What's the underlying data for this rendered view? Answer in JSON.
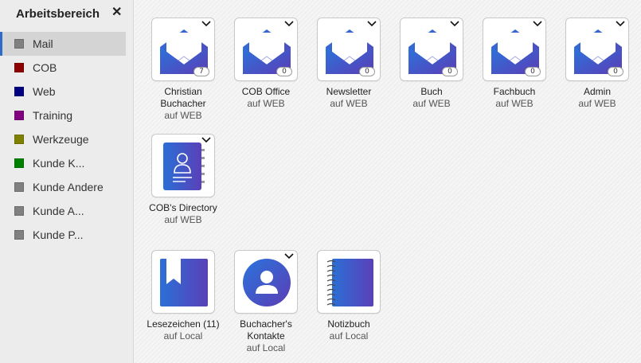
{
  "sidebar": {
    "title": "Arbeitsbereich",
    "close_icon": "close-icon",
    "items": [
      {
        "label": "Mail",
        "color": "#808080",
        "active": true
      },
      {
        "label": "COB",
        "color": "#8b0000"
      },
      {
        "label": "Web",
        "color": "#000080"
      },
      {
        "label": "Training",
        "color": "#800080"
      },
      {
        "label": "Werkzeuge",
        "color": "#808000"
      },
      {
        "label": "Kunde K...",
        "color": "#008000"
      },
      {
        "label": "Kunde Andere",
        "color": "#808080"
      },
      {
        "label": "Kunde A...",
        "color": "#808080"
      },
      {
        "label": "Kunde P...",
        "color": "#808080"
      }
    ]
  },
  "mail_tiles": [
    {
      "name": "Christian Buchacher",
      "sub": "auf WEB",
      "count": "7"
    },
    {
      "name": "COB Office",
      "sub": "auf WEB",
      "count": "0"
    },
    {
      "name": "Newsletter",
      "sub": "auf WEB",
      "count": "0"
    },
    {
      "name": "Buch",
      "sub": "auf WEB",
      "count": "0"
    },
    {
      "name": "Fachbuch",
      "sub": "auf WEB",
      "count": "0"
    },
    {
      "name": "Admin",
      "sub": "auf WEB",
      "count": "0"
    }
  ],
  "directory_tile": {
    "name": "COB's Directory",
    "sub": "auf WEB"
  },
  "local_tiles": [
    {
      "name": "Lesezeichen (11)",
      "sub": "auf Local",
      "icon": "bookmark-icon"
    },
    {
      "name": "Buchacher's Kontakte",
      "sub": "auf Local",
      "icon": "contact-icon"
    },
    {
      "name": "Notizbuch",
      "sub": "auf Local",
      "icon": "notebook-icon"
    }
  ],
  "colors": {
    "icon_gradient_start": "#2f6fd8",
    "icon_gradient_end": "#5a3fb8"
  }
}
